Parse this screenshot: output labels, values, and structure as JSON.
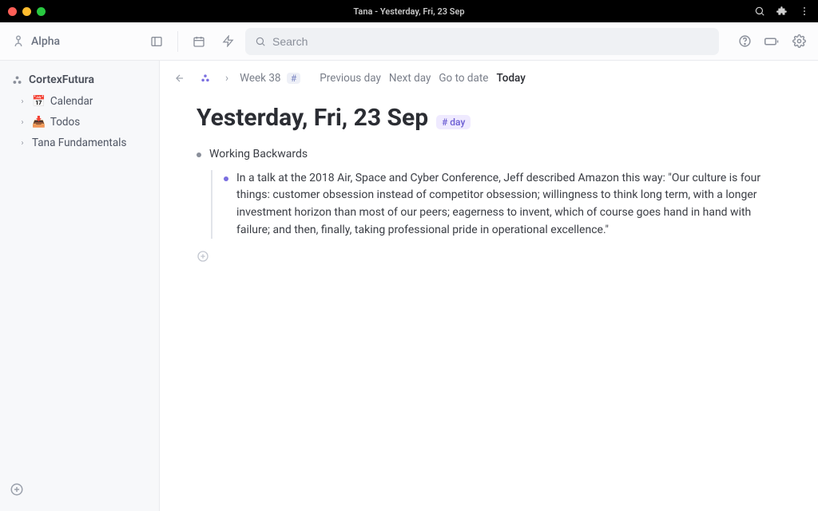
{
  "window": {
    "title": "Tana - Yesterday, Fri, 23 Sep"
  },
  "brand": {
    "name": "Alpha"
  },
  "search": {
    "placeholder": "Search"
  },
  "sidebar": {
    "workspace": "CortexFutura",
    "items": [
      {
        "emoji": "📅",
        "label": "Calendar"
      },
      {
        "emoji": "📥",
        "label": "Todos"
      },
      {
        "emoji": "",
        "label": "Tana Fundamentals"
      }
    ]
  },
  "breadcrumbs": {
    "week": "Week 38",
    "navlinks": {
      "prev": "Previous day",
      "next": "Next day",
      "goto": "Go to date",
      "today": "Today"
    }
  },
  "page": {
    "title": "Yesterday, Fri, 23 Sep",
    "tag": "# day",
    "nodes": [
      {
        "text": "Working Backwards",
        "children": [
          {
            "text": "In a talk at the 2018 Air, Space and Cyber Conference, Jeff described Amazon this way: \"Our culture is four things: customer obsession instead of competitor obsession; willingness to think long term, with a longer investment horizon than most of our peers; eagerness to invent, which of course goes hand in hand with failure; and then, finally, taking professional pride in operational excellence.\""
          }
        ]
      }
    ]
  }
}
